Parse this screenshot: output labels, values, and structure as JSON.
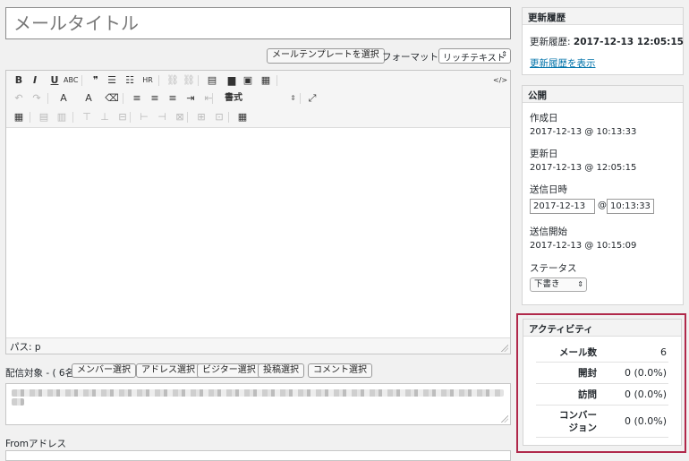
{
  "title_placeholder": "メールタイトル",
  "template_button": "メールテンプレートを選択",
  "format": {
    "label": "フォーマット:",
    "value": "リッチテキスト"
  },
  "editor": {
    "format_select": "書式",
    "path_label": "パス: p",
    "toolbar_row1": [
      {
        "name": "bold-icon",
        "g": "B"
      },
      {
        "name": "italic-icon",
        "g": "I"
      },
      {
        "name": "underline-icon",
        "g": "U"
      },
      {
        "name": "strikethrough-icon",
        "g": "ABC"
      },
      {
        "name": "blockquote-icon",
        "g": "❞"
      },
      {
        "name": "bullet-list-icon",
        "g": "☰"
      },
      {
        "name": "numbered-list-icon",
        "g": "☷"
      },
      {
        "name": "horizontal-rule-icon",
        "g": "HR"
      },
      {
        "name": "link-icon",
        "g": "⛓"
      },
      {
        "name": "unlink-icon",
        "g": "⛓"
      },
      {
        "name": "template-icon",
        "g": "▤"
      },
      {
        "name": "document-icon",
        "g": "▆"
      },
      {
        "name": "image-icon",
        "g": "▣"
      },
      {
        "name": "code-block-icon",
        "g": "▦"
      },
      {
        "name": "source-code-icon",
        "g": "</>"
      }
    ],
    "toolbar_row2": [
      {
        "name": "undo-icon",
        "g": "↶"
      },
      {
        "name": "redo-icon",
        "g": "↷"
      },
      {
        "name": "text-color-icon",
        "g": "A"
      },
      {
        "name": "background-color-icon",
        "g": "A"
      },
      {
        "name": "clear-format-icon",
        "g": "⌫"
      },
      {
        "name": "align-left-icon",
        "g": "≡"
      },
      {
        "name": "align-center-icon",
        "g": "≡"
      },
      {
        "name": "align-right-icon",
        "g": "≡"
      },
      {
        "name": "indent-icon",
        "g": "⇥"
      },
      {
        "name": "outdent-icon",
        "g": "⇤"
      },
      {
        "name": "fullscreen-icon",
        "g": "⤢"
      }
    ],
    "toolbar_row3": [
      {
        "name": "table-icon",
        "g": "▦"
      },
      {
        "name": "table-row-icon",
        "g": "▤"
      },
      {
        "name": "table-col-icon",
        "g": "▥"
      },
      {
        "name": "insert-row-before-icon",
        "g": "⊤"
      },
      {
        "name": "insert-row-after-icon",
        "g": "⊥"
      },
      {
        "name": "delete-row-icon",
        "g": "⊟"
      },
      {
        "name": "insert-col-before-icon",
        "g": "⊢"
      },
      {
        "name": "insert-col-after-icon",
        "g": "⊣"
      },
      {
        "name": "delete-col-icon",
        "g": "⊠"
      },
      {
        "name": "split-cell-icon",
        "g": "⊞"
      },
      {
        "name": "merge-cell-icon",
        "g": "⊡"
      },
      {
        "name": "grid-icon",
        "g": "▦"
      }
    ]
  },
  "recipients": {
    "label": "配信対象 - ( 6名 )",
    "buttons": [
      "メンバー選択",
      "アドレス選択",
      "ビジター選択",
      "投稿選択",
      "コメント選択"
    ]
  },
  "from_label": "Fromアドレス",
  "history": {
    "title": "更新履歴",
    "line_label": "更新履歴: ",
    "line_value": "2017-12-13 12:05:15",
    "link": "更新履歴を表示"
  },
  "publish": {
    "title": "公開",
    "created_label": "作成日",
    "created_value": "2017-12-13 @ 10:13:33",
    "updated_label": "更新日",
    "updated_value": "2017-12-13 @ 12:05:15",
    "send_datetime_label": "送信日時",
    "send_date": "2017-12-13",
    "at": "@",
    "send_time": "10:13:33",
    "send_start_label": "送信開始",
    "send_start_value": "2017-12-13 @ 10:15:09",
    "status_label": "ステータス",
    "status_value": "下書き"
  },
  "activity": {
    "title": "アクティビティ",
    "rows": [
      {
        "label": "メール数",
        "value": "6"
      },
      {
        "label": "開封",
        "value": "0 (0.0%)"
      },
      {
        "label": "訪問",
        "value": "0 (0.0%)"
      },
      {
        "label": "コンバー\nジョン",
        "value": "0 (0.0%)"
      }
    ]
  },
  "colors": {
    "link": "#0073aa",
    "highlight_frame": "#b0284a"
  }
}
